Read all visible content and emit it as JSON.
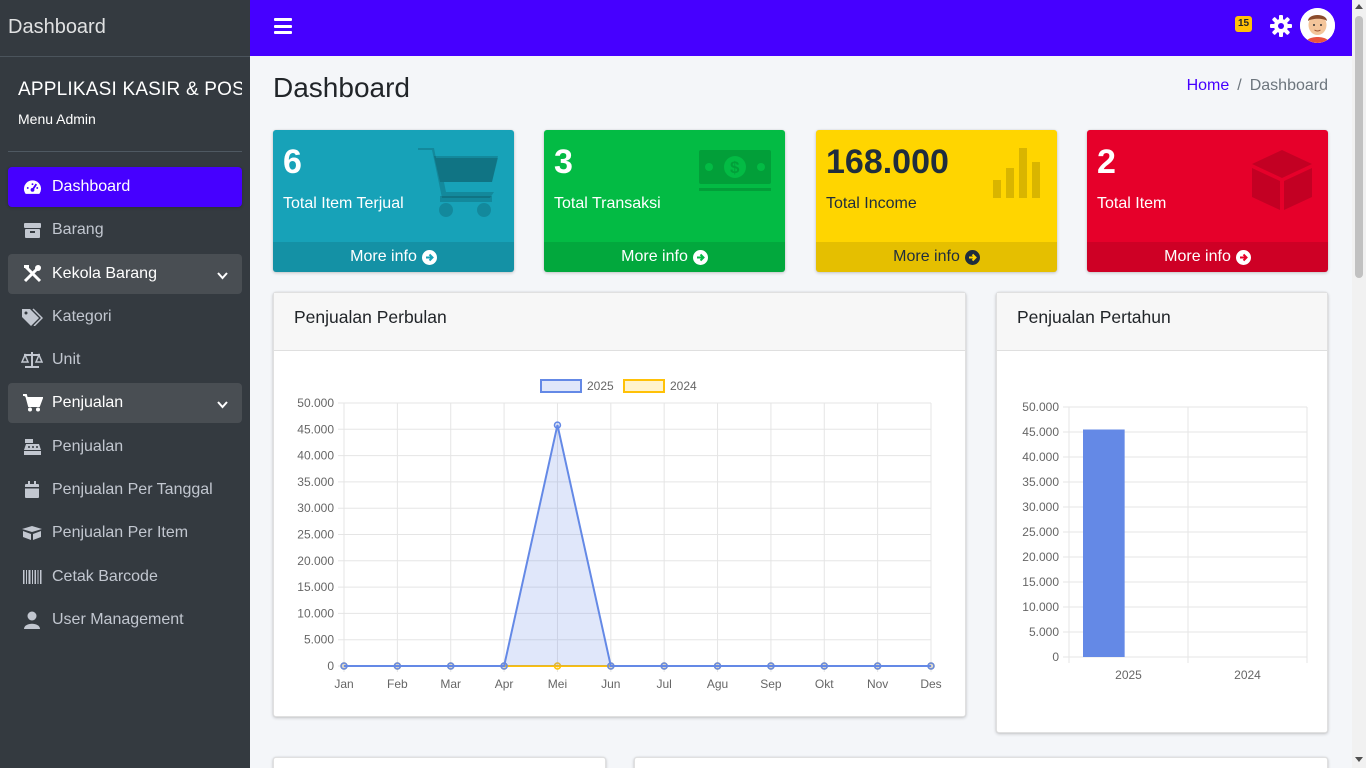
{
  "sidebar": {
    "brand": "Dashboard",
    "app_title": "APPLIKASI KASIR & POS",
    "role": "Menu Admin",
    "items": [
      {
        "label": "Dashboard",
        "icon": "gauge-icon"
      },
      {
        "label": "Barang",
        "icon": "box-archive-icon"
      },
      {
        "label": "Kekola Barang",
        "icon": "tools-icon"
      },
      {
        "label": "Kategori",
        "icon": "tags-icon"
      },
      {
        "label": "Unit",
        "icon": "balance-scale-icon"
      },
      {
        "label": "Penjualan",
        "icon": "cart-icon"
      },
      {
        "label": "Penjualan",
        "icon": "cash-register-icon"
      },
      {
        "label": "Penjualan Per Tanggal",
        "icon": "calendar-icon"
      },
      {
        "label": "Penjualan Per Item",
        "icon": "boxes-icon"
      },
      {
        "label": "Cetak Barcode",
        "icon": "barcode-icon"
      },
      {
        "label": "User Management",
        "icon": "user-icon"
      }
    ]
  },
  "navbar": {
    "notification_count": "15",
    "accent_color": "#4600ff"
  },
  "content": {
    "title": "Dashboard",
    "breadcrumb": {
      "home": "Home",
      "current": "Dashboard"
    }
  },
  "stat_boxes": [
    {
      "value": "6",
      "label": "Total Item Terjual",
      "link": "More info",
      "color": "#17a2b8"
    },
    {
      "value": "3",
      "label": "Total Transaksi",
      "link": "More info",
      "color": "#03bb44"
    },
    {
      "value": "168.000",
      "label": "Total Income",
      "link": "More info",
      "color": "#ffd500"
    },
    {
      "value": "2",
      "label": "Total Item",
      "link": "More info",
      "color": "#e6002a"
    }
  ],
  "cards": {
    "monthly_title": "Penjualan Perbulan",
    "yearly_title": "Penjualan Pertahun"
  },
  "chart_data": [
    {
      "type": "line",
      "title": "Penjualan Perbulan",
      "x": [
        "Jan",
        "Feb",
        "Mar",
        "Apr",
        "Mei",
        "Jun",
        "Jul",
        "Agu",
        "Sep",
        "Okt",
        "Nov",
        "Des"
      ],
      "series": [
        {
          "name": "2025",
          "values": [
            0,
            0,
            0,
            0,
            45800,
            0,
            0,
            0,
            0,
            0,
            0,
            0
          ],
          "color": "#6489e6"
        },
        {
          "name": "2024",
          "values": [
            0,
            0,
            0,
            0,
            0,
            0,
            0,
            0,
            0,
            0,
            0,
            0
          ],
          "color": "#ffc107"
        }
      ],
      "ylim": [
        0,
        50000
      ],
      "y_ticks": [
        "0",
        "5.000",
        "10.000",
        "15.000",
        "20.000",
        "25.000",
        "30.000",
        "35.000",
        "40.000",
        "45.000",
        "50.000"
      ],
      "grid": true,
      "legend": "top"
    },
    {
      "type": "bar",
      "title": "Penjualan Pertahun",
      "categories": [
        "2025",
        "2024"
      ],
      "values": [
        45500,
        0
      ],
      "color": "#6489e6",
      "ylim": [
        0,
        50000
      ],
      "y_ticks": [
        "0",
        "5.000",
        "10.000",
        "15.000",
        "20.000",
        "25.000",
        "30.000",
        "35.000",
        "40.000",
        "45.000",
        "50.000"
      ],
      "grid": true
    }
  ]
}
